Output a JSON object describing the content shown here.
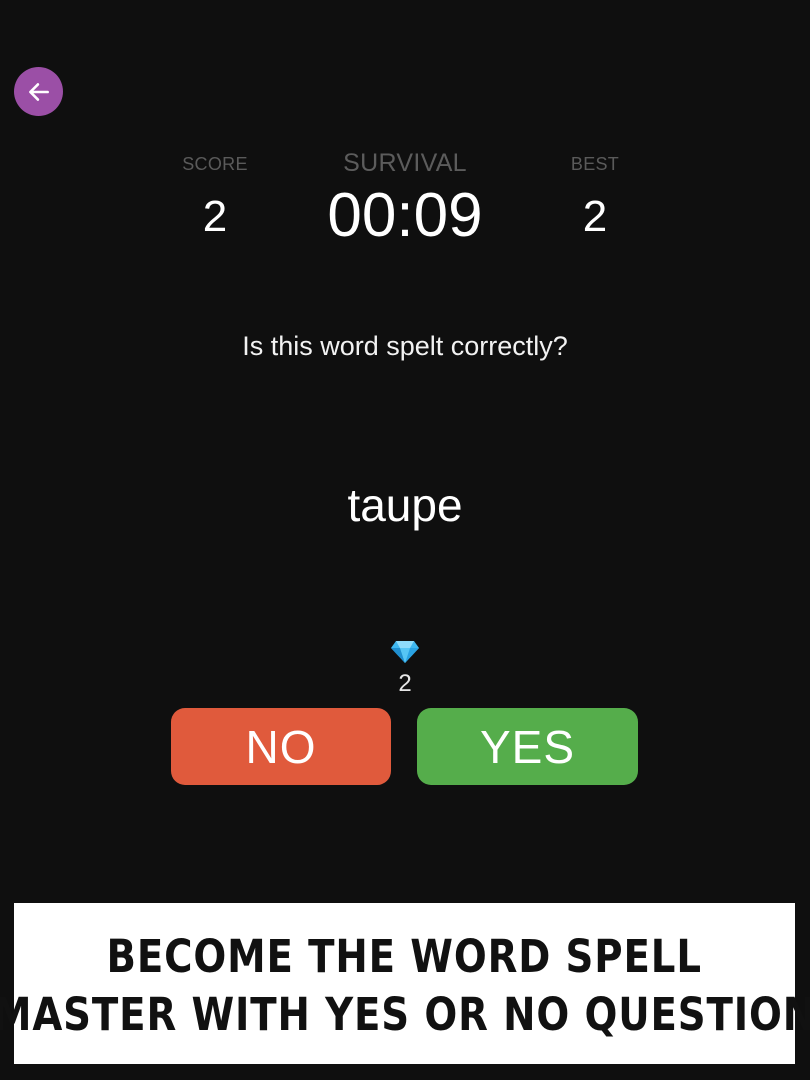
{
  "header": {
    "back_icon": "arrow-left-icon",
    "back_button_color": "#9b4fa6"
  },
  "stats": {
    "score_label": "SCORE",
    "score_value": "2",
    "mode_label": "SURVIVAL",
    "timer": "00:09",
    "best_label": "BEST",
    "best_value": "2"
  },
  "quiz": {
    "question": "Is this word spelt correctly?",
    "word": "taupe"
  },
  "gems": {
    "icon": "diamond-icon",
    "count": "2"
  },
  "answers": {
    "no_label": "NO",
    "no_color": "#e05a3c",
    "yes_label": "YES",
    "yes_color": "#55ad4b"
  },
  "banner": {
    "line1": "BECOME THE WORD SPELL",
    "line2": "MASTER WITH YES OR NO QUESTION"
  }
}
